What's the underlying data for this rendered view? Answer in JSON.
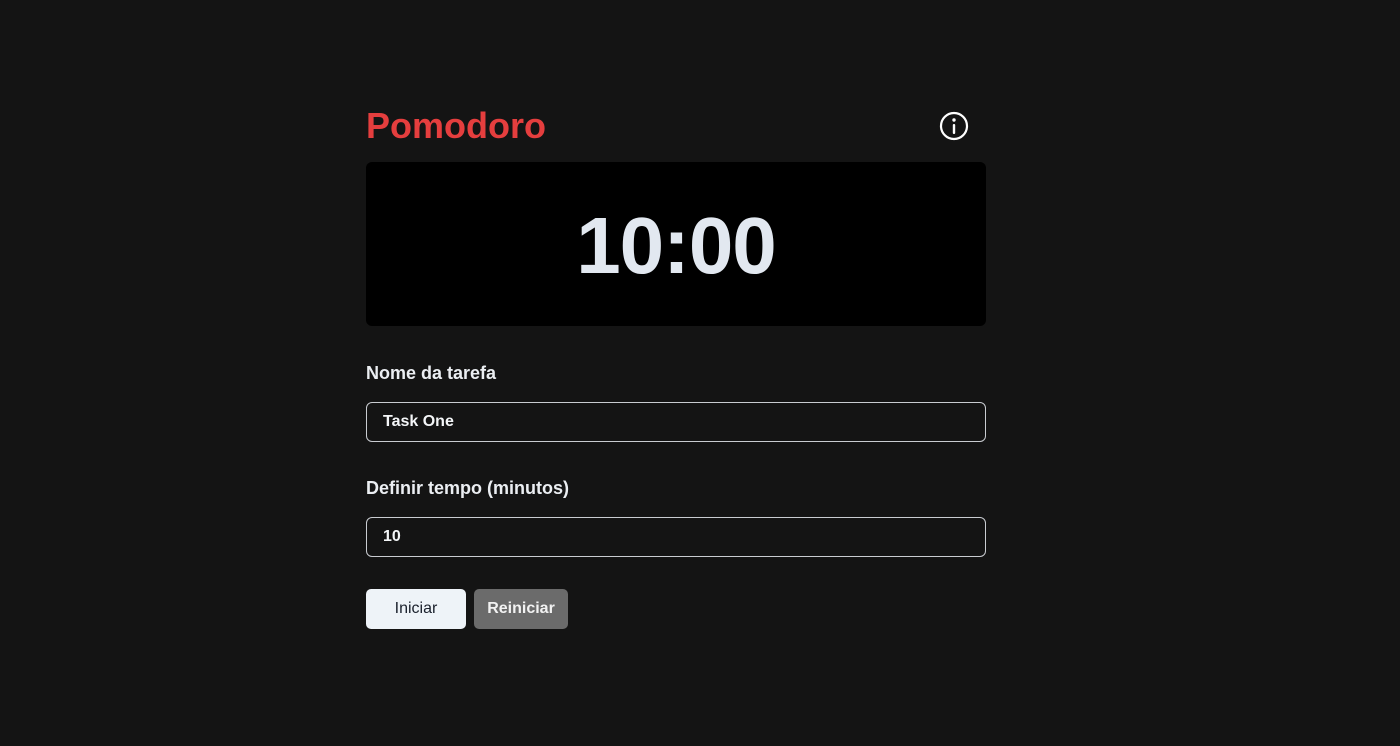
{
  "header": {
    "title": "Pomodoro",
    "info_icon": "info-circle-icon"
  },
  "timer": {
    "display": "10:00"
  },
  "task": {
    "label": "Nome da tarefa",
    "value": "Task One"
  },
  "time": {
    "label": "Definir tempo (minutos)",
    "value": "10"
  },
  "actions": {
    "start_label": "Iniciar",
    "reset_label": "Reiniciar"
  },
  "colors": {
    "background": "#141414",
    "accent": "#e53e3e",
    "timer_bg": "#000000",
    "timer_text": "#e2e8f0",
    "start_bg": "#eef3f8",
    "reset_bg": "#6b6b6b"
  }
}
